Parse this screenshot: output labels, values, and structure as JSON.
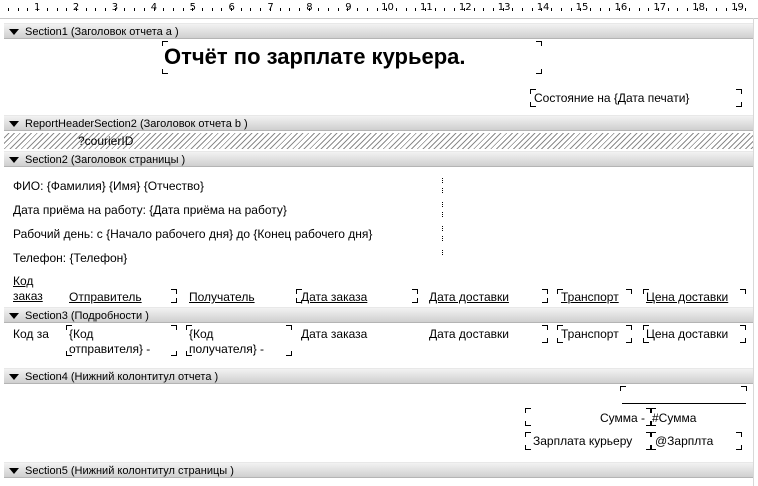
{
  "ruler": {
    "numbers": [
      "1",
      "2",
      "3",
      "4",
      "5",
      "6",
      "7",
      "8",
      "9",
      "10",
      "11",
      "12",
      "13",
      "14",
      "15",
      "16",
      "17",
      "18",
      "19"
    ]
  },
  "sections": {
    "s1": "Section1 (Заголовок отчета а )",
    "rh2": "ReportHeaderSection2 (Заголовок отчета b )",
    "s2": "Section2 (Заголовок страницы  )",
    "s3": "Section3 (Подробности  )",
    "s4": "Section4 (Нижний колонтитул отчета  )",
    "s5": "Section5 (Нижний колонтитул страницы  )"
  },
  "report_header": {
    "title": "Отчёт по зарплате курьера.",
    "status": "Состояние на {Дата печати}"
  },
  "header_b": {
    "param": "?courierID"
  },
  "page_header": {
    "fio": "ФИО: {Фамилия} {Имя} {Отчество}",
    "hire": "Дата приёма на работу: {Дата приёма на работу}",
    "workday": "Рабочий день: с {Начало рабочего дня} до {Конец рабочего дня}",
    "phone": "Телефон: {Телефон}",
    "columns": {
      "order_code_1": "Код",
      "order_code_2": "заказ",
      "sender": "Отправитель",
      "receiver": "Получатель",
      "order_date": "Дата заказа",
      "delivery_date": "Дата доставки",
      "transport": "Транспорт",
      "price": "Цена доставки"
    }
  },
  "details": {
    "order_code": "Код за",
    "sender_1": "{Код",
    "sender_2": "отправителя} -",
    "receiver_1": "{Код",
    "receiver_2": "получателя} -",
    "order_date": "Дата заказа",
    "delivery_date": "Дата доставки",
    "transport": "Транспорт",
    "price": "Цена доставки"
  },
  "report_footer": {
    "sum_label": "Сумма -",
    "sum_value": "#Сумма",
    "salary_label": "Зарплата курьеру",
    "salary_value": "@Зарплта"
  }
}
